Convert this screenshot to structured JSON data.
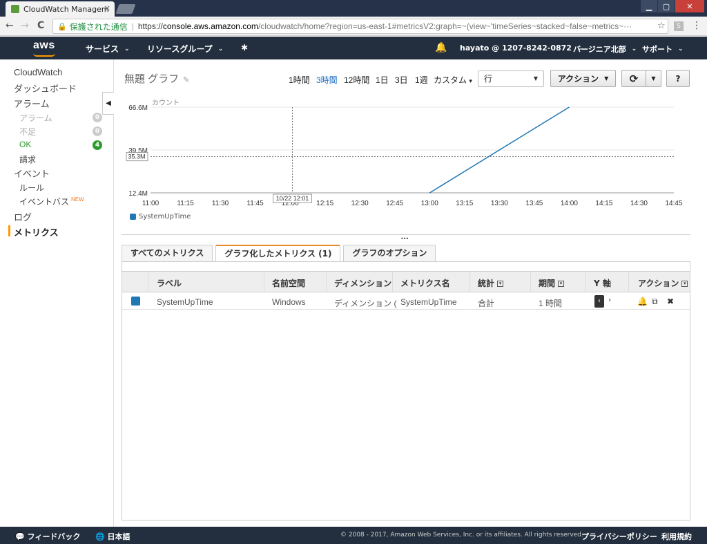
{
  "browser": {
    "tab_title": "CloudWatch Managem",
    "tab_close": "×",
    "secure_label": "保護された通信",
    "url_scheme": "https://",
    "url_host": "console.aws.amazon.com",
    "url_path": "/cloudwatch/home?region=us-east-1#metricsV2:graph=~(view~'timeSeries~stacked~false~metrics~···",
    "ext_label": "S",
    "win_min": "▁",
    "win_max": "▢",
    "win_close": "✕",
    "nav_back": "←",
    "nav_forward": "→",
    "nav_reload": "C",
    "lock": "🔒",
    "star": "☆",
    "menu": "⋮"
  },
  "aws": {
    "logo": "aws",
    "services": "サービス",
    "resource_groups": "リソースグループ",
    "caret": "⌄",
    "pin": "✱",
    "bell": "🔔",
    "account": "hayato @ 1207-8242-0872",
    "region": "バージニア北部",
    "support": "サポート"
  },
  "sidebar": {
    "cloudwatch": "CloudWatch",
    "dashboard": "ダッシュボード",
    "alarms": "アラーム",
    "alarm_alarm": "アラーム",
    "alarm_alarm_count": "0",
    "alarm_insufficient": "不足",
    "alarm_insufficient_count": "0",
    "alarm_ok": "OK",
    "alarm_ok_count": "4",
    "billing": "請求",
    "events": "イベント",
    "rules": "ルール",
    "event_bus": "イベントバス",
    "new_badge": "NEW",
    "logs": "ログ",
    "metrics": "メトリクス",
    "collapse": "◀"
  },
  "graph": {
    "title": "無題 グラフ",
    "edit_icon": "✎",
    "ranges": [
      "1時間",
      "3時間",
      "12時間",
      "1日",
      "3日",
      "1週",
      "カスタム"
    ],
    "custom_caret": "▾",
    "view_select": "行",
    "select_caret": "▼",
    "actions_button": "アクション",
    "actions_caret": "▼",
    "refresh_icon": "⟳",
    "refresh_caret": "▼",
    "help_icon": "?",
    "handle": "•••"
  },
  "chart_data": {
    "type": "line",
    "ylabel": "カウント",
    "y_ticks": [
      "66.6M",
      "39.5M",
      "12.4M"
    ],
    "y_tick_values": [
      66.6,
      39.5,
      12.4
    ],
    "ylim": [
      12.4,
      66.6
    ],
    "x_ticks": [
      "11:00",
      "11:15",
      "11:30",
      "11:45",
      "12:00",
      "12:15",
      "12:30",
      "12:45",
      "13:00",
      "13:15",
      "13:30",
      "13:45",
      "14:00",
      "14:15",
      "14:30",
      "14:45"
    ],
    "crosshair_x_label": "10/22 12:01",
    "crosshair_x_value": 12.0167,
    "crosshair_y_label": "35.3M",
    "crosshair_y_value": 35.3,
    "series": [
      {
        "name": "SystemUpTime",
        "color": "#1f77b4",
        "x": [
          13.0,
          14.0
        ],
        "y": [
          12.4,
          66.6
        ]
      }
    ]
  },
  "tabs": {
    "all_metrics": "すべてのメトリクス",
    "graphed_metrics": "グラフ化したメトリクス (1)",
    "graph_options": "グラフのオプション"
  },
  "table": {
    "headers": {
      "label": "ラベル",
      "namespace": "名前空間",
      "dimensions": "ディメンション",
      "metric_name": "メトリクス名",
      "statistic": "統計",
      "period": "期間",
      "y_axis": "Y 軸",
      "actions": "アクション"
    },
    "sort_icon": "▾",
    "rows": [
      {
        "label": "SystemUpTime",
        "namespace": "Windows",
        "dimensions": "ディメンション (",
        "metric_name": "SystemUpTime",
        "statistic": "合計",
        "period": "1 時間",
        "axis_left": "‹",
        "axis_right": "›",
        "alarm_icon": "🔔",
        "copy_icon": "⧉",
        "remove_icon": "✖"
      }
    ]
  },
  "footer": {
    "feedback_icon": "💬",
    "feedback": "フィードバック",
    "globe_icon": "🌐",
    "language": "日本語",
    "copyright": "© 2008 - 2017, Amazon Web Services, Inc. or its affiliates. All rights reserved.",
    "privacy": "プライバシーポリシー",
    "terms": "利用規約"
  }
}
